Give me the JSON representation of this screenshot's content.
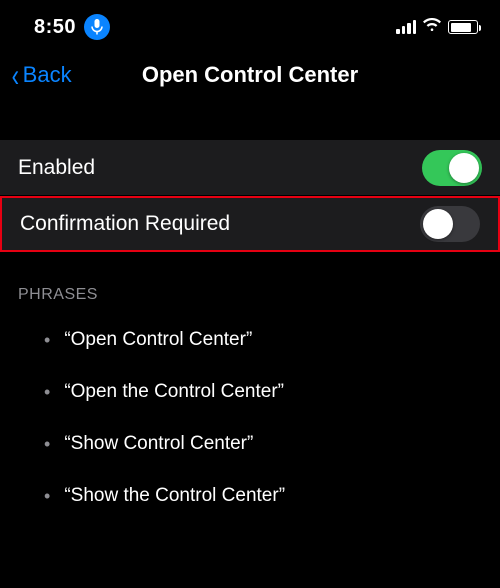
{
  "status": {
    "time": "8:50"
  },
  "nav": {
    "back": "Back",
    "title": "Open Control Center"
  },
  "settings": {
    "enabled": {
      "label": "Enabled",
      "on": true
    },
    "confirmation": {
      "label": "Confirmation Required",
      "on": false
    }
  },
  "phrases": {
    "header": "PHRASES",
    "items": [
      "“Open Control Center”",
      "“Open the Control Center”",
      "“Show Control Center”",
      "“Show the Control Center”"
    ]
  }
}
